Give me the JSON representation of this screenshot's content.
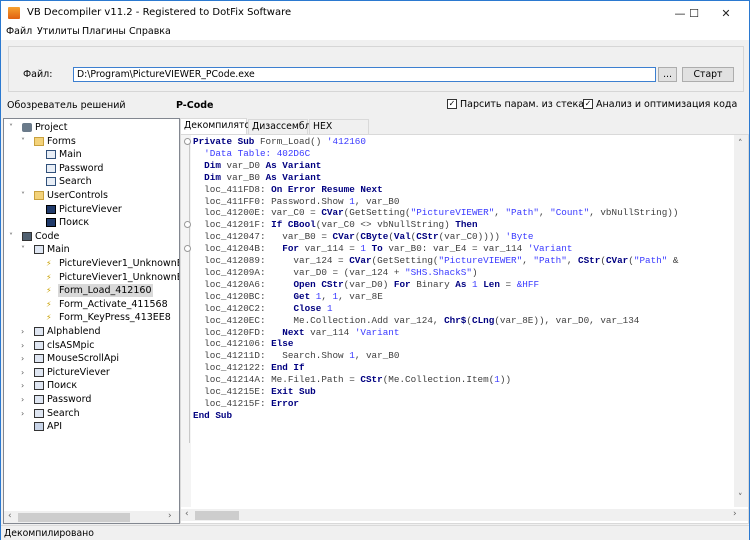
{
  "window": {
    "title": "VB Decompiler v11.2 - Registered to DotFix Software",
    "minimize": "—",
    "maximize": "☐",
    "close": "✕"
  },
  "menu": [
    "Файл",
    "Утилиты",
    "Плагины",
    "Справка"
  ],
  "toolbar": {
    "file_label": "Файл:",
    "file_value": "D:\\Program\\PictureVIEWER_PCode.exe",
    "browse_label": "...",
    "start_label": "Старт"
  },
  "explorer_title": "Обозреватель решений",
  "pane_title": "P-Code",
  "options": [
    {
      "label": "Парсить парам. из стека",
      "checked": true
    },
    {
      "label": "Анализ и оптимизация кода",
      "checked": true
    }
  ],
  "tree": [
    {
      "label": "Project",
      "level": 0,
      "icon": "project",
      "exp": "v"
    },
    {
      "label": "Forms",
      "level": 1,
      "icon": "folder",
      "exp": "v"
    },
    {
      "label": "Main",
      "level": 2,
      "icon": "form",
      "exp": ""
    },
    {
      "label": "Password",
      "level": 2,
      "icon": "form",
      "exp": ""
    },
    {
      "label": "Search",
      "level": 2,
      "icon": "form",
      "exp": ""
    },
    {
      "label": "UserControls",
      "level": 1,
      "icon": "folder",
      "exp": "v"
    },
    {
      "label": "PictureViever",
      "level": 2,
      "icon": "usercontrol",
      "exp": ""
    },
    {
      "label": "Поиск",
      "level": 2,
      "icon": "usercontrol",
      "exp": ""
    },
    {
      "label": "Code",
      "level": 0,
      "icon": "code",
      "exp": "v"
    },
    {
      "label": "Main",
      "level": 1,
      "icon": "module",
      "exp": "v"
    },
    {
      "label": "PictureViever1_UnknownEvent",
      "level": 2,
      "icon": "event",
      "exp": ""
    },
    {
      "label": "PictureViever1_UnknownEvent",
      "level": 2,
      "icon": "event",
      "exp": ""
    },
    {
      "label": "Form_Load_412160",
      "level": 2,
      "icon": "event",
      "exp": "",
      "selected": true
    },
    {
      "label": "Form_Activate_411568",
      "level": 2,
      "icon": "event",
      "exp": ""
    },
    {
      "label": "Form_KeyPress_413EE8",
      "level": 2,
      "icon": "event",
      "exp": ""
    },
    {
      "label": "Alphablend",
      "level": 1,
      "icon": "module",
      "exp": ">"
    },
    {
      "label": "clsASMpic",
      "level": 1,
      "icon": "module",
      "exp": ">"
    },
    {
      "label": "MouseScrollApi",
      "level": 1,
      "icon": "module",
      "exp": ">"
    },
    {
      "label": "PictureViever",
      "level": 1,
      "icon": "module",
      "exp": ">"
    },
    {
      "label": "Поиск",
      "level": 1,
      "icon": "module",
      "exp": ">"
    },
    {
      "label": "Password",
      "level": 1,
      "icon": "module",
      "exp": ">"
    },
    {
      "label": "Search",
      "level": 1,
      "icon": "module",
      "exp": ">"
    },
    {
      "label": "API",
      "level": 1,
      "icon": "api",
      "exp": ""
    }
  ],
  "tabs": [
    {
      "label": "Декомпилятор",
      "active": true
    },
    {
      "label": "Дизассемблер",
      "active": false
    },
    {
      "label": "HEX Редактор",
      "active": false
    }
  ],
  "code_lines": [
    [
      [
        "k",
        "Private Sub"
      ],
      [
        "t",
        " Form_Load() "
      ],
      [
        "c",
        "'412160"
      ]
    ],
    [
      [
        "t",
        "  "
      ],
      [
        "c",
        "'Data Table: 402D6C"
      ]
    ],
    [
      [
        "t",
        "  "
      ],
      [
        "k",
        "Dim"
      ],
      [
        "t",
        " var_D0 "
      ],
      [
        "k",
        "As Variant"
      ]
    ],
    [
      [
        "t",
        "  "
      ],
      [
        "k",
        "Dim"
      ],
      [
        "t",
        " var_B0 "
      ],
      [
        "k",
        "As Variant"
      ]
    ],
    [
      [
        "t",
        "  loc_411FD8: "
      ],
      [
        "k",
        "On Error Resume Next"
      ]
    ],
    [
      [
        "t",
        "  loc_411FF0: Password.Show "
      ],
      [
        "s",
        "1"
      ],
      [
        "t",
        ", var_B0"
      ]
    ],
    [
      [
        "t",
        "  loc_41200E: var_C0 = "
      ],
      [
        "k",
        "CVar"
      ],
      [
        "t",
        "(GetSetting("
      ],
      [
        "s",
        "\"PictureVIEWER\""
      ],
      [
        "t",
        ", "
      ],
      [
        "s",
        "\"Path\""
      ],
      [
        "t",
        ", "
      ],
      [
        "s",
        "\"Count\""
      ],
      [
        "t",
        ", vbNullString))"
      ]
    ],
    [
      [
        "t",
        "  loc_41201F: "
      ],
      [
        "k",
        "If CBool"
      ],
      [
        "t",
        "(var_C0 <> vbNullString) "
      ],
      [
        "k",
        "Then"
      ]
    ],
    [
      [
        "t",
        "  loc_412047:   var_B0 = "
      ],
      [
        "k",
        "CVar"
      ],
      [
        "t",
        "("
      ],
      [
        "k",
        "CByte"
      ],
      [
        "t",
        "("
      ],
      [
        "k",
        "Val"
      ],
      [
        "t",
        "("
      ],
      [
        "k",
        "CStr"
      ],
      [
        "t",
        "(var_C0)))) "
      ],
      [
        "c",
        "'Byte"
      ]
    ],
    [
      [
        "t",
        "  loc_41204B:   "
      ],
      [
        "k",
        "For"
      ],
      [
        "t",
        " var_114 = "
      ],
      [
        "s",
        "1"
      ],
      [
        "t",
        " "
      ],
      [
        "k",
        "To"
      ],
      [
        "t",
        " var_B0: var_E4 = var_114 "
      ],
      [
        "c",
        "'Variant"
      ]
    ],
    [
      [
        "t",
        "  loc_412089:     var_124 = "
      ],
      [
        "k",
        "CVar"
      ],
      [
        "t",
        "(GetSetting("
      ],
      [
        "s",
        "\"PictureVIEWER\""
      ],
      [
        "t",
        ", "
      ],
      [
        "s",
        "\"Path\""
      ],
      [
        "t",
        ", "
      ],
      [
        "k",
        "CStr"
      ],
      [
        "t",
        "("
      ],
      [
        "k",
        "CVar"
      ],
      [
        "t",
        "("
      ],
      [
        "s",
        "\"Path\""
      ],
      [
        "t",
        " & "
      ]
    ],
    [
      [
        "t",
        "  loc_41209A:     var_D0 = (var_124 + "
      ],
      [
        "s",
        "\"SHS.ShackS\""
      ],
      [
        "t",
        ")"
      ]
    ],
    [
      [
        "t",
        "  loc_4120A6:     "
      ],
      [
        "k",
        "Open CStr"
      ],
      [
        "t",
        "(var_D0) "
      ],
      [
        "k",
        "For"
      ],
      [
        "t",
        " Binary "
      ],
      [
        "k",
        "As"
      ],
      [
        "t",
        " "
      ],
      [
        "s",
        "1"
      ],
      [
        "t",
        " "
      ],
      [
        "k",
        "Len"
      ],
      [
        "t",
        " = "
      ],
      [
        "s",
        "&HFF"
      ]
    ],
    [
      [
        "t",
        "  loc_4120BC:     "
      ],
      [
        "k",
        "Get"
      ],
      [
        "t",
        " "
      ],
      [
        "s",
        "1"
      ],
      [
        "t",
        ", "
      ],
      [
        "s",
        "1"
      ],
      [
        "t",
        ", var_8E"
      ]
    ],
    [
      [
        "t",
        "  loc_4120C2:     "
      ],
      [
        "k",
        "Close"
      ],
      [
        "t",
        " "
      ],
      [
        "s",
        "1"
      ]
    ],
    [
      [
        "t",
        "  loc_4120EC:     Me.Collection.Add var_124, "
      ],
      [
        "k",
        "Chr$"
      ],
      [
        "t",
        "("
      ],
      [
        "k",
        "CLng"
      ],
      [
        "t",
        "(var_8E)), var_D0, var_134"
      ]
    ],
    [
      [
        "t",
        "  loc_4120FD:   "
      ],
      [
        "k",
        "Next"
      ],
      [
        "t",
        " var_114 "
      ],
      [
        "c",
        "'Variant"
      ]
    ],
    [
      [
        "t",
        "  loc_412106: "
      ],
      [
        "k",
        "Else"
      ]
    ],
    [
      [
        "t",
        "  loc_41211D:   Search.Show "
      ],
      [
        "s",
        "1"
      ],
      [
        "t",
        ", var_B0"
      ]
    ],
    [
      [
        "t",
        "  loc_412122: "
      ],
      [
        "k",
        "End If"
      ]
    ],
    [
      [
        "t",
        "  loc_41214A: Me.File1.Path = "
      ],
      [
        "k",
        "CStr"
      ],
      [
        "t",
        "(Me.Collection.Item("
      ],
      [
        "s",
        "1"
      ],
      [
        "t",
        "))"
      ]
    ],
    [
      [
        "t",
        "  loc_41215E: "
      ],
      [
        "k",
        "Exit Sub"
      ]
    ],
    [
      [
        "t",
        "  loc_41215F: "
      ],
      [
        "k",
        "Error"
      ]
    ],
    [
      [
        "k",
        "End Sub"
      ]
    ]
  ],
  "status": "Декомпилировано"
}
